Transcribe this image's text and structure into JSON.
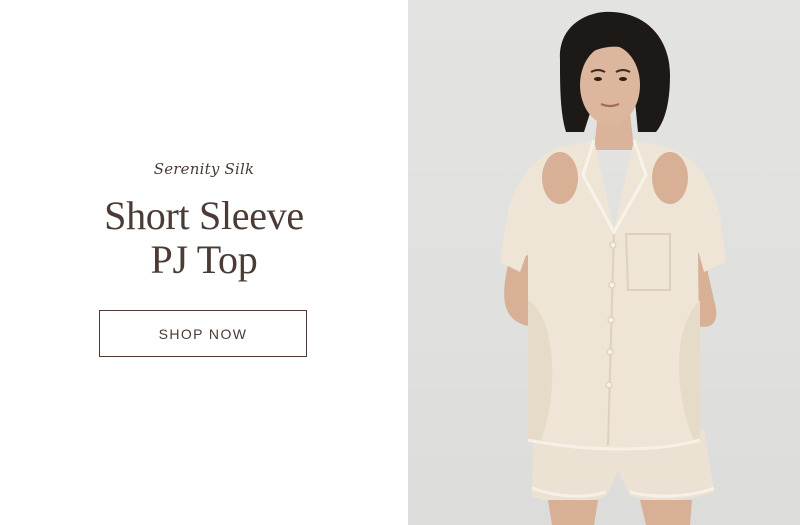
{
  "collection": "Serenity Silk",
  "headline": {
    "line1": "Short Sleeve",
    "line2": "PJ Top"
  },
  "cta_label": "SHOP NOW",
  "colors": {
    "text": "#4a3b34",
    "background": "#ffffff",
    "photo_background": "#e0e0de",
    "silk": "#efe5d6"
  },
  "product_image": {
    "subject": "model wearing cream silk short sleeve pajama top and shorts"
  }
}
